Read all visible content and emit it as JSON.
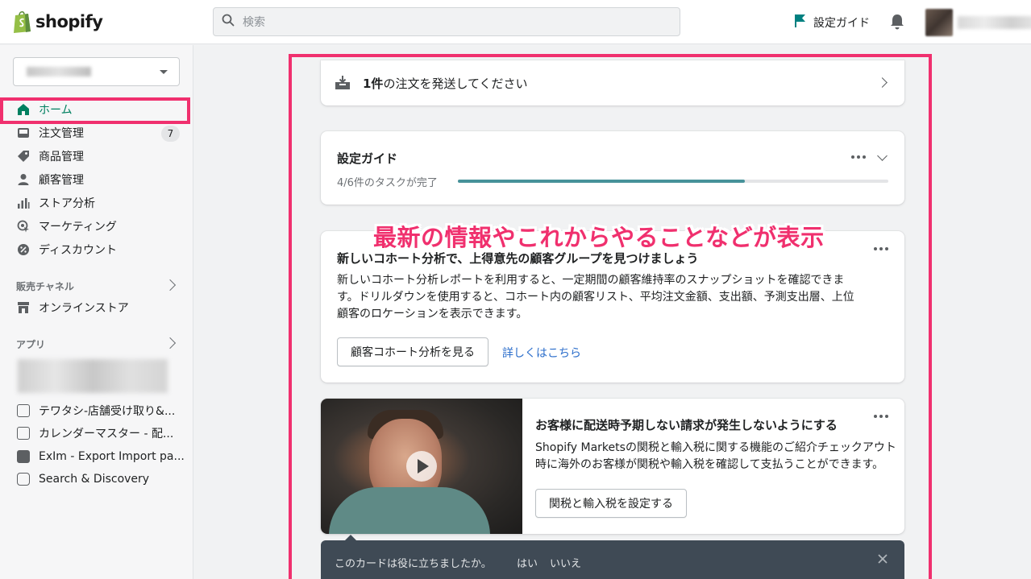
{
  "topbar": {
    "logo_text": "shopify",
    "search_placeholder": "検索",
    "setup_guide": "設定ガイド"
  },
  "sidebar": {
    "nav": [
      {
        "label": "ホーム"
      },
      {
        "label": "注文管理",
        "badge": "7"
      },
      {
        "label": "商品管理"
      },
      {
        "label": "顧客管理"
      },
      {
        "label": "ストア分析"
      },
      {
        "label": "マーケティング"
      },
      {
        "label": "ディスカウント"
      }
    ],
    "sales_channels_title": "販売チャネル",
    "online_store": "オンラインストア",
    "apps_title": "アプリ",
    "apps": [
      "テワタシ-店舗受け取り&...",
      "カレンダーマスター - 配...",
      "ExIm - Export Import pa...",
      "Search & Discovery"
    ]
  },
  "orders_card": {
    "count": "1件",
    "text": "の注文を発送してください"
  },
  "setup_card": {
    "title": "設定ガイド",
    "progress_text": "4/6件のタスクが完了",
    "progress": 0.667
  },
  "overlay_annotation": "最新の情報やこれからやることなどが表示",
  "cohort_card": {
    "title": "新しいコホート分析で、上得意先の顧客グループを見つけましょう",
    "body_lines": [
      "新しいコホート分析レポートを利用すると、一定期間の顧客維持率のスナップショットを確認できま",
      "す。ドリルダウンを使用すると、コホート内の顧客リスト、平均注文金額、支出額、予測支出層、上位",
      "顧客のロケーションを表示できます。"
    ],
    "button": "顧客コホート分析を見る",
    "link": "詳しくはこちら"
  },
  "duties_card": {
    "title": "お客様に配送時予期しない請求が発生しないようにする",
    "body_lines": [
      "Shopify Marketsの関税と輸入税に関する機能のご紹介チェックアウト",
      "時に海外のお客様が関税や輸入税を確認して支払うことができます。"
    ],
    "button": "関税と輸入税を設定する"
  },
  "feedback": {
    "question": "このカードは役に立ちましたか。",
    "yes": "はい",
    "no": "いいえ"
  },
  "colors": {
    "accent_green": "#008060",
    "highlight_pink": "#f0306e",
    "progress_teal": "#47929a",
    "link_blue": "#2c6ecb"
  }
}
